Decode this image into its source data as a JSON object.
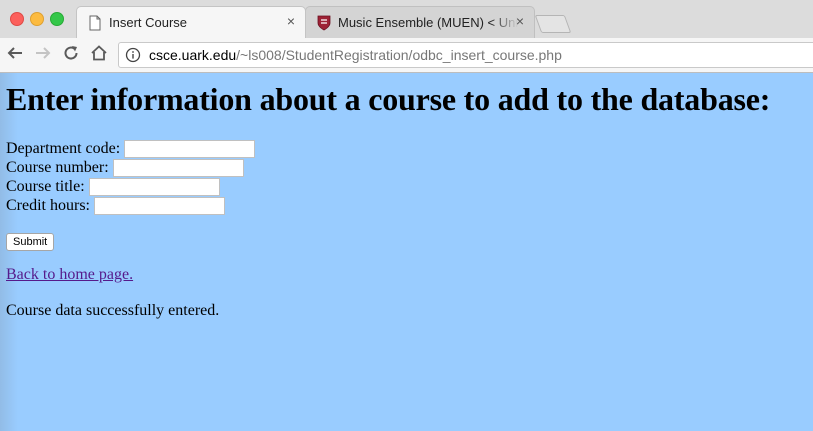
{
  "browser": {
    "tabs": [
      {
        "title": "Insert Course",
        "active": true,
        "icon": "document-icon"
      },
      {
        "title": "Music Ensemble (MUEN) < University of Arkansas",
        "active": false,
        "icon": "shield-crest-icon"
      }
    ],
    "tab_close_glyph": "×",
    "url_host": "csce.uark.edu",
    "url_path": "/~ls008/StudentRegistration/odbc_insert_course.php"
  },
  "page": {
    "heading": "Enter information about a course to add to the database:",
    "fields": [
      {
        "label": "Department code:",
        "value": ""
      },
      {
        "label": "Course number:",
        "value": ""
      },
      {
        "label": "Course title:",
        "value": ""
      },
      {
        "label": "Credit hours:",
        "value": ""
      }
    ],
    "submit_label": "Submit",
    "home_link": "Back to home page.",
    "status_message": "Course data successfully entered."
  },
  "colors": {
    "page_background": "#99ccff",
    "visited_link": "#551a8b"
  }
}
